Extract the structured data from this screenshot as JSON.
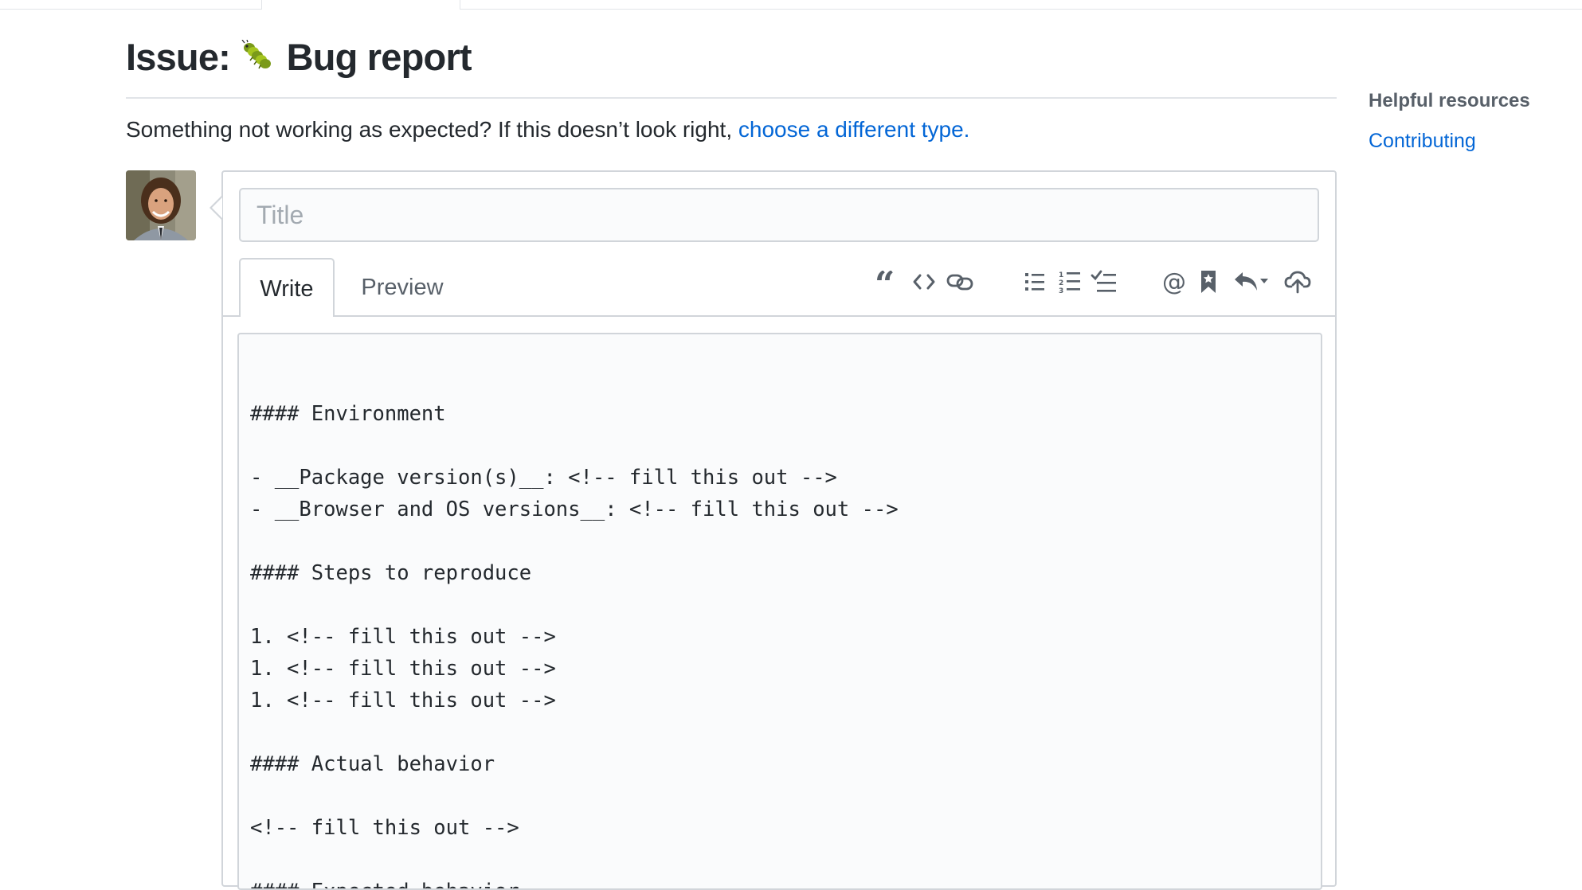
{
  "page": {
    "title_prefix": "Issue:",
    "title_emoji": "🐛",
    "title_text": "Bug report",
    "subtitle_text": "Something not working as expected? If this doesn’t look right, ",
    "subtitle_link": "choose a different type."
  },
  "sidebar": {
    "heading": "Helpful resources",
    "links": [
      "Contributing"
    ]
  },
  "form": {
    "title_placeholder": "Title",
    "tabs": {
      "write": "Write",
      "preview": "Preview"
    },
    "toolbar_icons": [
      "quote-icon",
      "code-icon",
      "link-icon",
      "unordered-list-icon",
      "ordered-list-icon",
      "task-list-icon",
      "mention-icon",
      "reference-icon",
      "reply-icon",
      "upload-icon"
    ],
    "body": "\n#### Environment\n\n- __Package version(s)__: <!-- fill this out -->\n- __Browser and OS versions__: <!-- fill this out -->\n\n#### Steps to reproduce\n\n1. <!-- fill this out -->\n1. <!-- fill this out -->\n1. <!-- fill this out -->\n\n#### Actual behavior\n\n<!-- fill this out -->\n\n#### Expected behavior"
  },
  "colors": {
    "link": "#0366d6",
    "text": "#24292e",
    "muted": "#586069",
    "border": "#d1d5da",
    "input_bg": "#fafbfc"
  }
}
